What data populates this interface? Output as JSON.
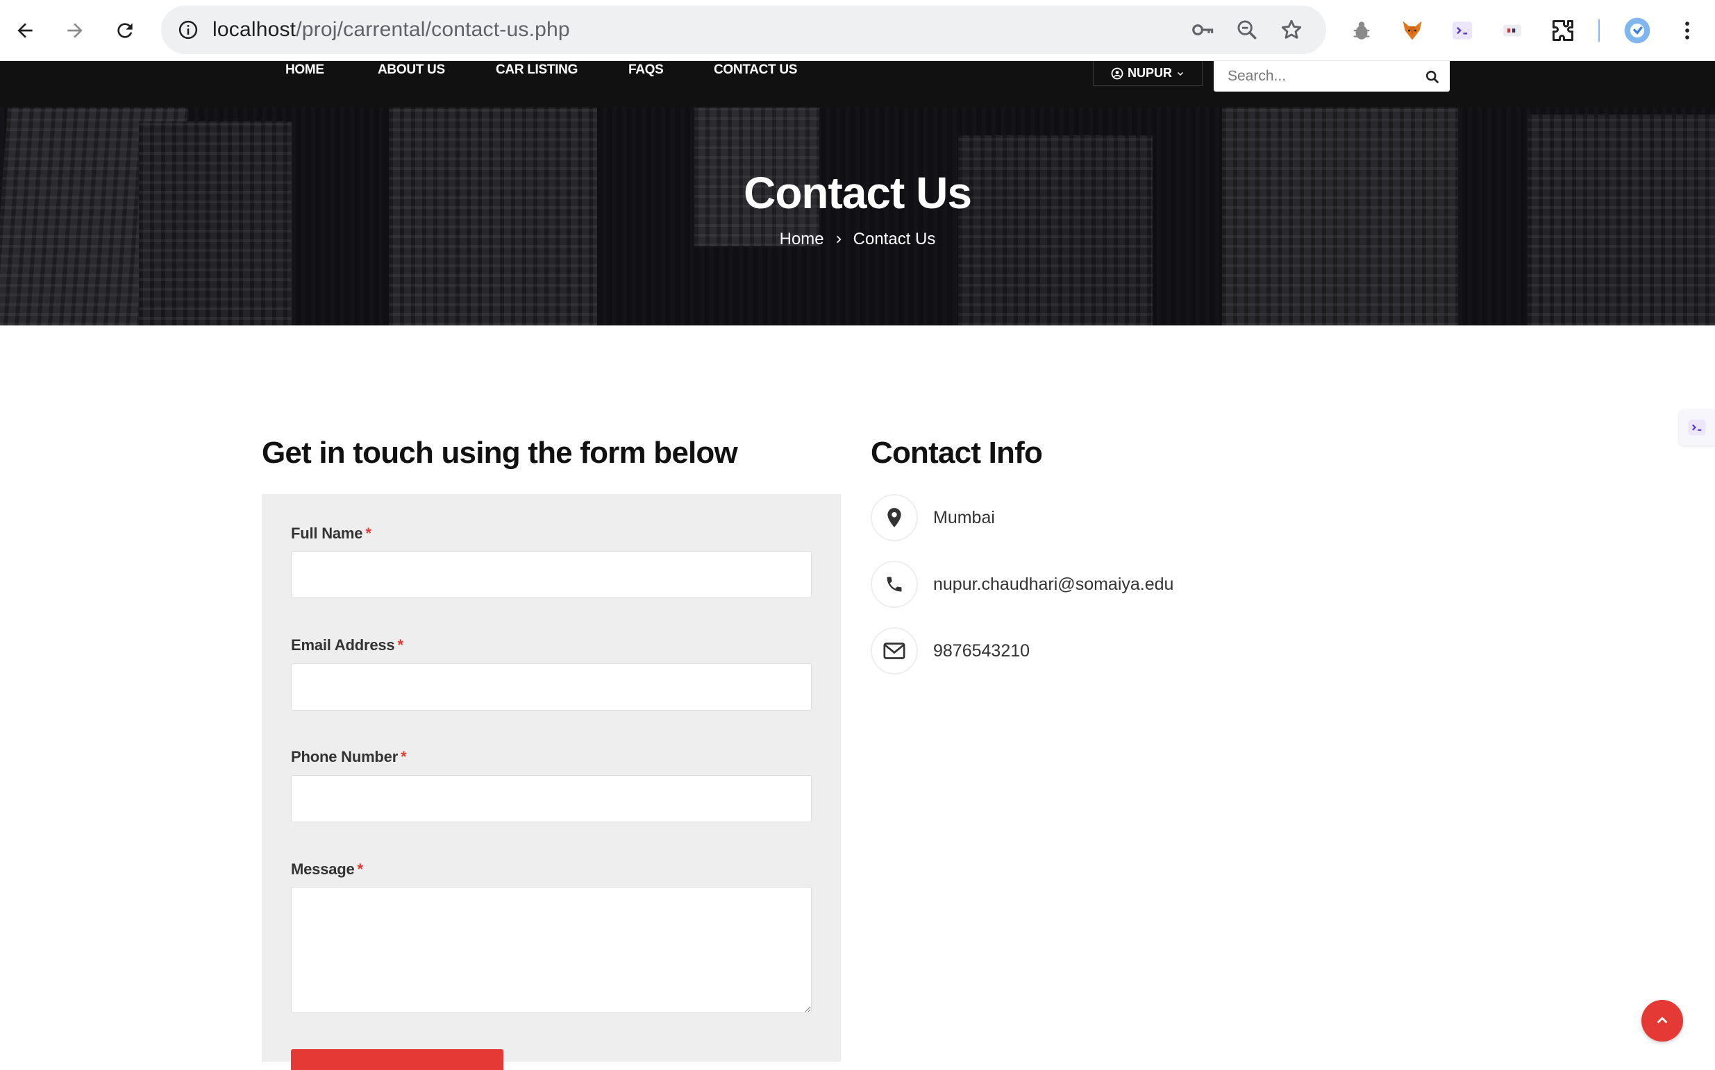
{
  "browser": {
    "url_host": "localhost",
    "url_path": "/proj/carrental/contact-us.php"
  },
  "nav": {
    "items": [
      {
        "label": "HOME"
      },
      {
        "label": "ABOUT US"
      },
      {
        "label": "CAR LISTING"
      },
      {
        "label": "FAQS"
      },
      {
        "label": "CONTACT US"
      }
    ],
    "user_label": "NUPUR",
    "search_placeholder": "Search..."
  },
  "hero": {
    "title": "Contact Us",
    "breadcrumb_home": "Home",
    "breadcrumb_current": "Contact Us"
  },
  "form": {
    "heading": "Get in touch using the form below",
    "fields": [
      {
        "label": "Full Name",
        "required_mark": "*"
      },
      {
        "label": "Email Address",
        "required_mark": "*"
      },
      {
        "label": "Phone Number",
        "required_mark": "*"
      },
      {
        "label": "Message",
        "required_mark": "*"
      }
    ]
  },
  "contact_info": {
    "heading": "Contact Info",
    "items": [
      {
        "icon": "map-pin-icon",
        "text": "Mumbai"
      },
      {
        "icon": "phone-icon",
        "text": "nupur.chaudhari@somaiya.edu"
      },
      {
        "icon": "envelope-icon",
        "text": "9876543210"
      }
    ]
  },
  "colors": {
    "accent": "#e53935",
    "navbar": "#111111",
    "panel": "#eeeeee"
  }
}
